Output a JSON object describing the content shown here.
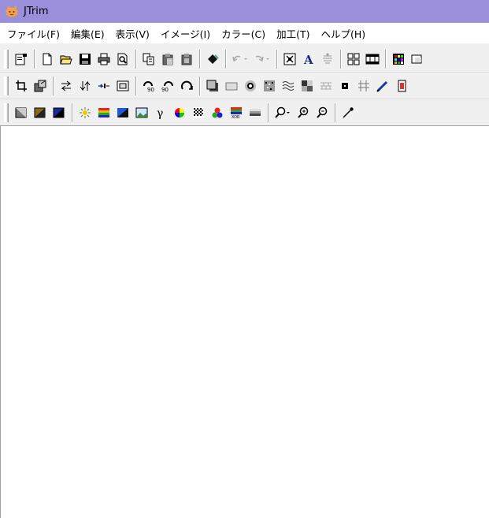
{
  "window": {
    "title": "JTrim",
    "titlebar_color": "#9b8fdb"
  },
  "menubar": {
    "items": [
      {
        "label": "ファイル(F)"
      },
      {
        "label": "編集(E)"
      },
      {
        "label": "表示(V)"
      },
      {
        "label": "イメージ(I)"
      },
      {
        "label": "カラー(C)"
      },
      {
        "label": "加工(T)"
      },
      {
        "label": "ヘルプ(H)"
      }
    ]
  },
  "toolbars": {
    "row1_icons": [
      "properties-icon",
      "new-file-icon",
      "open-folder-icon",
      "save-icon",
      "print-icon",
      "print-preview-icon",
      "copy-icon",
      "paste-icon",
      "paste-new-icon",
      "fill-icon",
      "undo-icon",
      "redo-icon",
      "fit-window-icon",
      "text-icon",
      "align-icon",
      "grid-view-icon",
      "filmstrip-icon",
      "color-palette-icon",
      "extra-icon"
    ],
    "row2_icons": [
      "crop-icon",
      "resize-icon",
      "flip-horizontal-icon",
      "flip-vertical-icon",
      "trim-icon",
      "frame-icon",
      "rotate-90-icon",
      "rotate-minus90-icon",
      "rotate-icon",
      "shadow-icon",
      "border-icon",
      "blur-icon",
      "noise-icon",
      "wave-icon",
      "mosaic-icon",
      "brick-icon",
      "spotlight-icon",
      "grid-icon",
      "pen-icon",
      "marker-icon"
    ],
    "row3_icons": [
      "grayscale-icon",
      "sepia-icon",
      "negative-icon",
      "brightness-icon",
      "color-balance-icon",
      "gradient-icon",
      "image-adjust-icon",
      "gamma-icon",
      "hue-icon",
      "dither-icon",
      "rgb-icon",
      "xor-icon",
      "level-icon",
      "zoom-icon",
      "zoom-in-icon",
      "zoom-out-icon",
      "eyedropper-icon"
    ]
  },
  "canvas": {
    "background": "#ffffff"
  }
}
